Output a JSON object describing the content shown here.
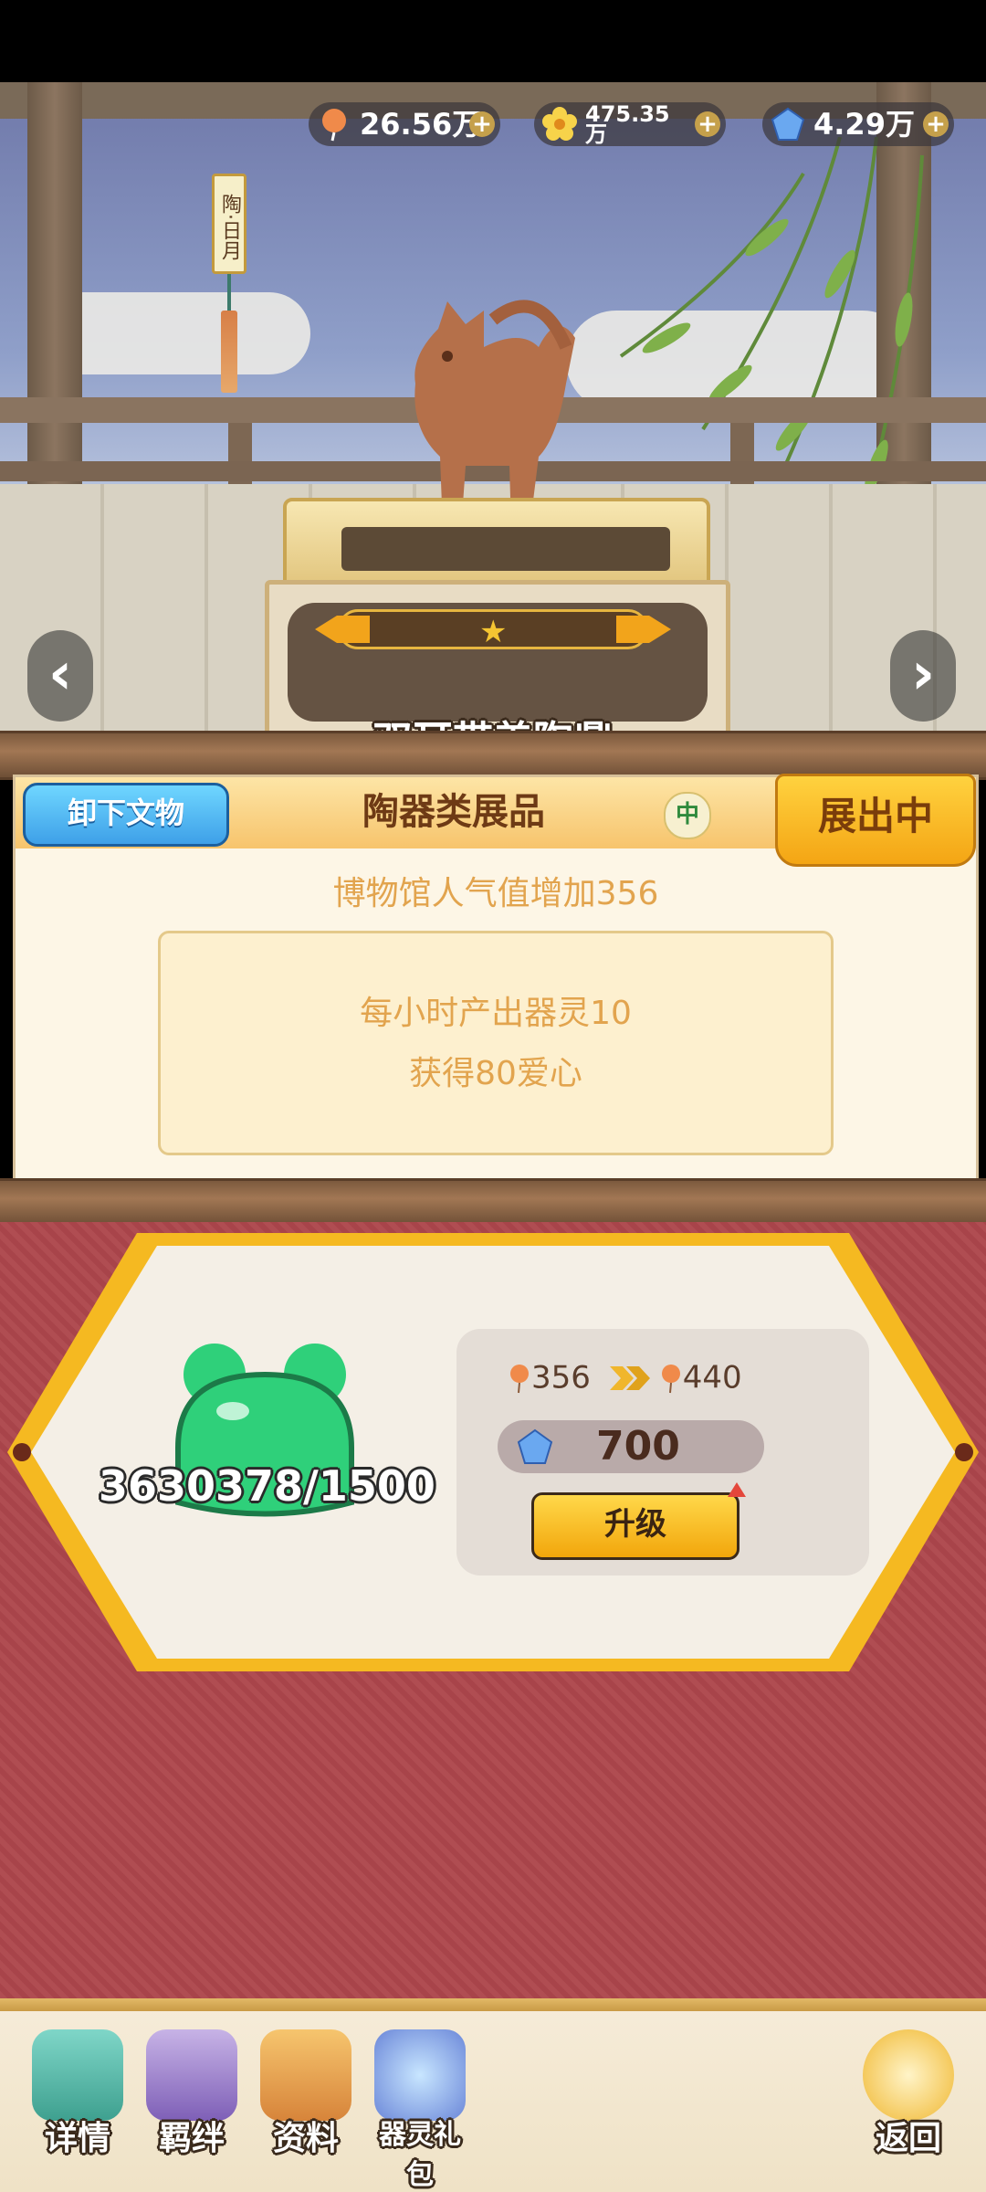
{
  "currencies": [
    {
      "icon": "balloon-icon",
      "value": "26.56万"
    },
    {
      "icon": "flower-icon",
      "value": "475.35万"
    },
    {
      "icon": "gem-icon",
      "value": "4.29万"
    }
  ],
  "relic": {
    "tag_text": "陶·日月",
    "name": "双耳带盖陶鼎",
    "stars": "★"
  },
  "panel": {
    "unload_label": "卸下文物",
    "category": "陶器类展品",
    "grade": "中",
    "status": "展出中",
    "popularity": "博物馆人气值增加356",
    "effects": [
      "每小时产出器灵10",
      "获得80爱心"
    ]
  },
  "upgrade": {
    "spirit_count": "3630378/1500",
    "pop_from": "356",
    "pop_to": "440",
    "cost": "700",
    "upgrade_label": "升级"
  },
  "bottom_nav": [
    {
      "icon": "details-icon",
      "label": "详情"
    },
    {
      "icon": "bond-icon",
      "label": "羁绊"
    },
    {
      "icon": "info-cards-icon",
      "label": "资料"
    },
    {
      "icon": "gift-box-icon",
      "label": "器灵礼包"
    },
    {
      "icon": "return-icon",
      "label": "返回"
    }
  ],
  "colors": {
    "accent_gold": "#f4a514",
    "info_blue": "#3ea0e8",
    "lower_red": "#b04d52",
    "slime_green": "#2fd07a"
  }
}
